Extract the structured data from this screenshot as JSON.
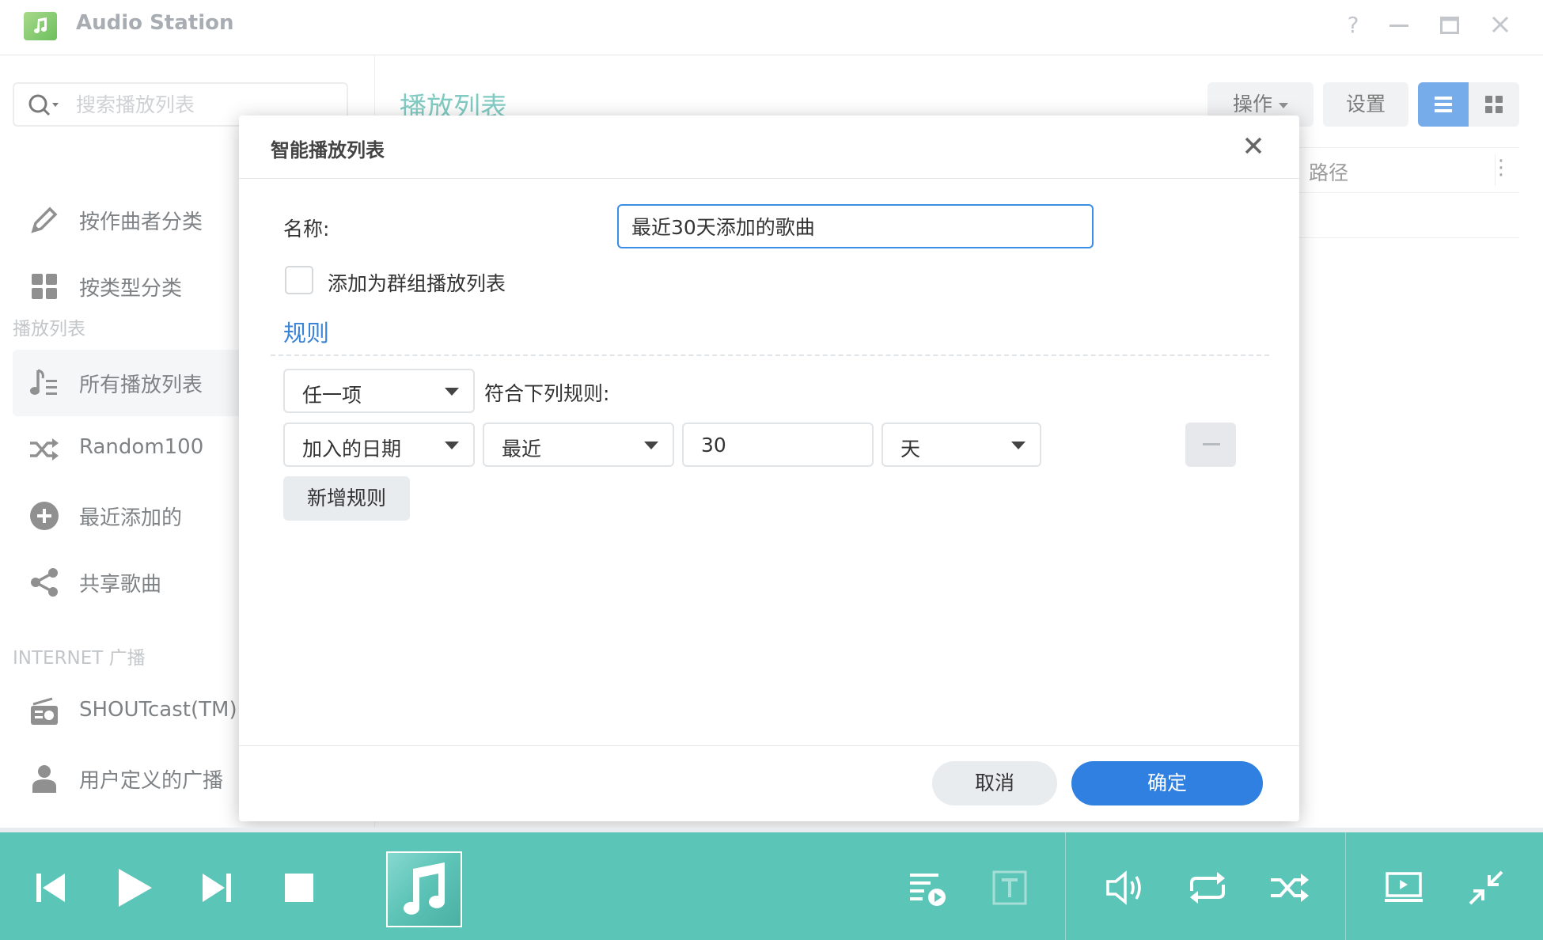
{
  "app": {
    "title": "Audio Station",
    "help": "?"
  },
  "sidebar": {
    "search_placeholder": "搜索播放列表",
    "items_top": [
      {
        "label": "按作曲者分类",
        "icon": "pencil-icon"
      },
      {
        "label": "按类型分类",
        "icon": "grid-icon"
      }
    ],
    "section_playlists": "播放列表",
    "playlists": [
      {
        "label": "所有播放列表",
        "icon": "playlist-icon",
        "active": true
      },
      {
        "label": "Random100",
        "icon": "shuffle-icon"
      },
      {
        "label": "最近添加的",
        "icon": "plus-circle-icon"
      },
      {
        "label": "共享歌曲",
        "icon": "share-icon"
      }
    ],
    "section_radio": "INTERNET 广播",
    "radio": [
      {
        "label": "SHOUTcast(TM)",
        "icon": "radio-icon"
      },
      {
        "label": "用户定义的广播",
        "icon": "user-icon"
      }
    ]
  },
  "main": {
    "title": "播放列表",
    "action_button": "操作",
    "settings_button": "设置",
    "column_path": "路径"
  },
  "dialog": {
    "title": "智能播放列表",
    "name_label": "名称:",
    "name_value": "最近30天添加的歌曲",
    "group_checkbox_label": "添加为群组播放列表",
    "group_checked": false,
    "rules_title": "规则",
    "match_select": "任一项",
    "match_suffix": "符合下列规则:",
    "rule": {
      "field": "加入的日期",
      "operator": "最近",
      "value": "30",
      "unit": "天"
    },
    "add_rule_button": "新增规则",
    "cancel_button": "取消",
    "ok_button": "确定"
  },
  "colors": {
    "accent_blue": "#2f80e0",
    "teal_title": "#3fb0a3",
    "player_bg": "#5bc5b7"
  }
}
